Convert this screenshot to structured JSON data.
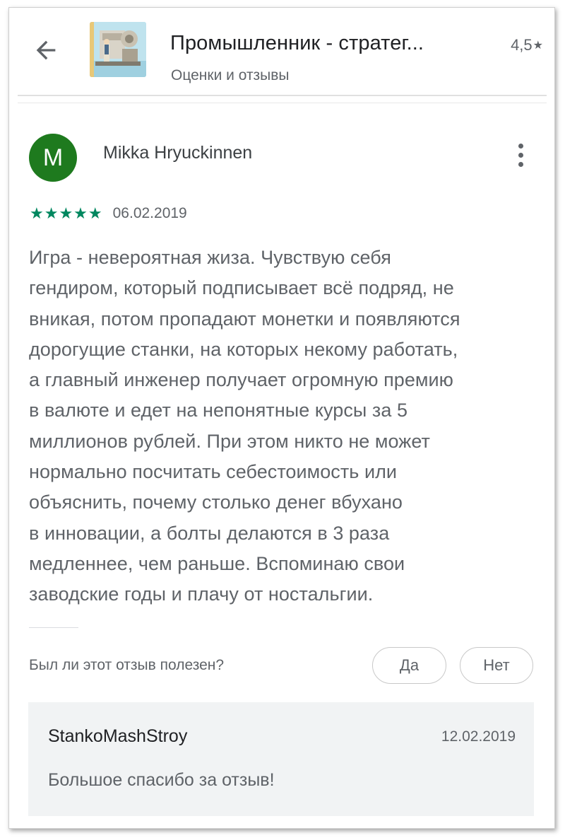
{
  "header": {
    "app_title": "Промышленник - стратег...",
    "subtitle": "Оценки и отзывы",
    "rating": "4,5",
    "rating_star": "★"
  },
  "review": {
    "avatar_letter": "M",
    "avatar_color": "#1e7a1e",
    "author": "Mikka Hryuckinnen",
    "stars": "★★★★★",
    "stars_value": 5,
    "star_color": "#01875f",
    "date": "06.02.2019",
    "lines": [
      "Игра - невероятная жиза. Чувствую себя",
      "гендиром, который подписывает всё подряд, не",
      "вникая, потом пропадают монетки и появляются",
      "дорогущие станки, на которых некому работать,",
      "а главный инженер получает огромную премию",
      "в валюте и едет на непонятные курсы за 5",
      "миллионов рублей. При этом никто не может",
      "нормально посчитать себестоимость или",
      "объяснить, почему столько денег вбухано",
      "в инновации, а болты делаются в 3 раза",
      "медленнее, чем раньше. Вспоминаю свои",
      "заводские годы и плачу от ностальгии."
    ]
  },
  "helpful": {
    "question": "Был ли этот отзыв полезен?",
    "yes_label": "Да",
    "no_label": "Нет"
  },
  "developer_reply": {
    "developer": "StankoMashStroy",
    "date": "12.02.2019",
    "text": "Большое спасибо за отзыв!"
  }
}
